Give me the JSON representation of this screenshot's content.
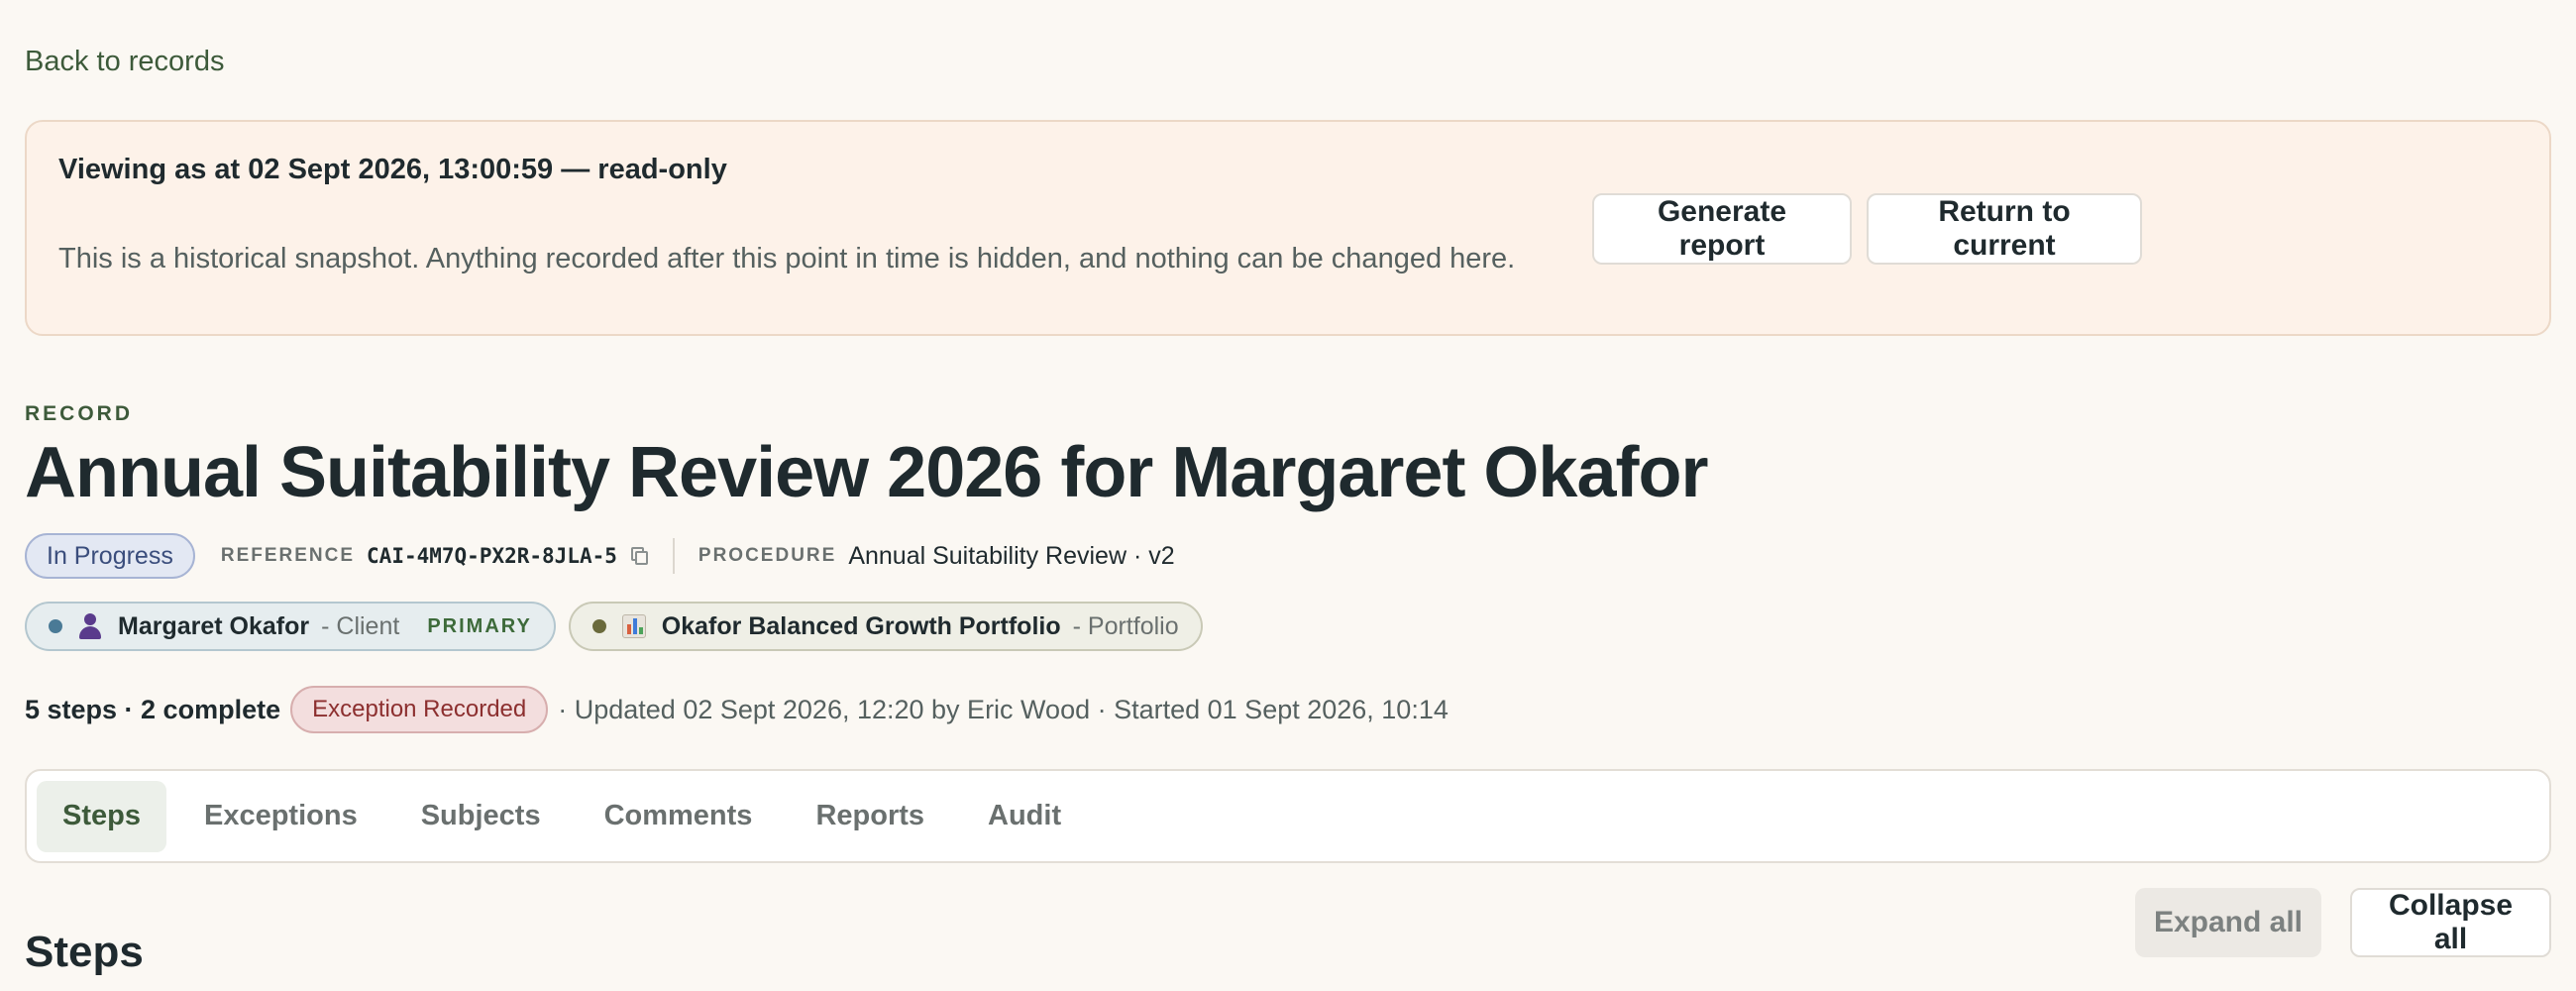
{
  "nav": {
    "back_label": "Back to records"
  },
  "snapshot": {
    "title": "Viewing as at 02 Sept 2026, 13:00:59 — read-only",
    "description": "This is a historical snapshot. Anything recorded after this point in time is hidden, and nothing can be changed here.",
    "generate_label": "Generate report",
    "return_label": "Return to current"
  },
  "record": {
    "eyebrow": "RECORD",
    "title": "Annual Suitability Review 2026 for Margaret Okafor",
    "status": "In Progress",
    "reference_label": "REFERENCE",
    "reference_value": "CAI-4M7Q-PX2R-8JLA-5",
    "procedure_label": "PROCEDURE",
    "procedure_value": "Annual Suitability Review · v2"
  },
  "subjects": [
    {
      "name": "Margaret Okafor",
      "role": "- Client",
      "tag": "PRIMARY",
      "icon": "person-icon"
    },
    {
      "name": "Okafor Balanced Growth Portfolio",
      "role": "- Portfolio",
      "icon": "bar-chart-icon"
    }
  ],
  "summary": {
    "steps": "5 steps · 2 complete",
    "exception_badge": "Exception Recorded",
    "updated": "· Updated 02 Sept 2026, 12:20 by Eric Wood · Started 01 Sept 2026, 10:14"
  },
  "tabs": [
    {
      "label": "Steps",
      "active": true
    },
    {
      "label": "Exceptions"
    },
    {
      "label": "Subjects"
    },
    {
      "label": "Comments"
    },
    {
      "label": "Reports"
    },
    {
      "label": "Audit"
    }
  ],
  "steps_section": {
    "title": "Steps",
    "expand_label": "Expand all",
    "collapse_label": "Collapse all"
  },
  "colors": {
    "background": "#fbf8f3",
    "accent": "#3d5a3a",
    "banner": "#fdf2e9",
    "status_pill": "#e3e8f3",
    "exception_pill": "#f3dede"
  }
}
